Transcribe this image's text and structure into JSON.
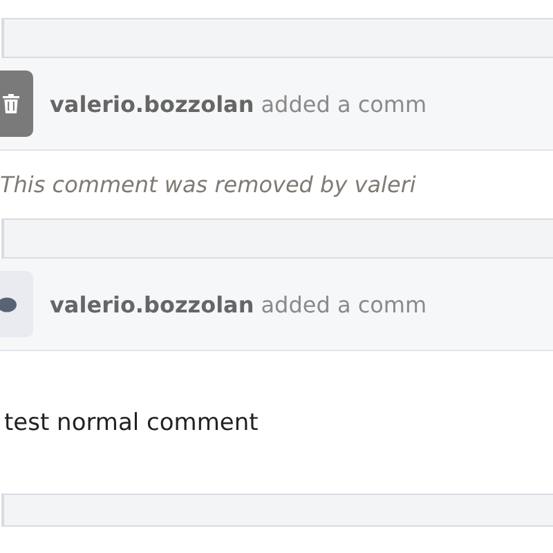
{
  "events": [
    {
      "kind": "deleted",
      "author": "valerio.bozzolan",
      "action": "added a comm",
      "body": "This comment was removed by valeri"
    },
    {
      "kind": "normal",
      "author": "valerio.bozzolan",
      "action": "added a comm",
      "body": "test normal comment"
    }
  ]
}
